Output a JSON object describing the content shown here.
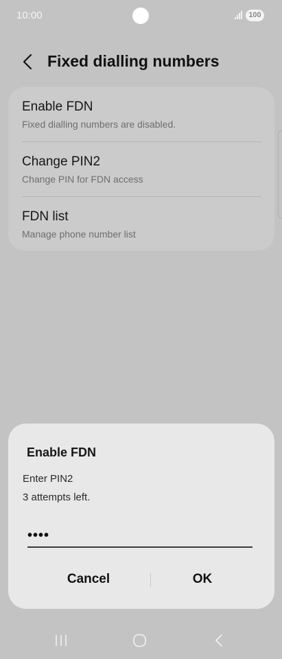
{
  "status_bar": {
    "time": "10:00",
    "battery": "100",
    "icons": [
      "camera-cutout",
      "signal-icon",
      "battery-icon"
    ]
  },
  "header": {
    "back_icon": "back-arrow-icon",
    "title": "Fixed dialling numbers"
  },
  "settings": {
    "items": [
      {
        "title": "Enable FDN",
        "subtitle": "Fixed dialling numbers are disabled."
      },
      {
        "title": "Change PIN2",
        "subtitle": "Change PIN for FDN access"
      },
      {
        "title": "FDN list",
        "subtitle": "Manage phone number list"
      }
    ]
  },
  "dialog": {
    "title": "Enable FDN",
    "message_line1": "Enter PIN2",
    "message_line2": "3 attempts left.",
    "pin_value": "••••",
    "cancel_label": "Cancel",
    "ok_label": "OK"
  },
  "nav_bar": {
    "icons": [
      "recent-apps-icon",
      "home-icon",
      "back-icon"
    ]
  },
  "colors": {
    "background": "#c3c3c3",
    "card": "#cbcbcb",
    "dialog": "#e8e8e8",
    "text_primary": "#161616",
    "text_secondary": "#6e6e6e"
  }
}
